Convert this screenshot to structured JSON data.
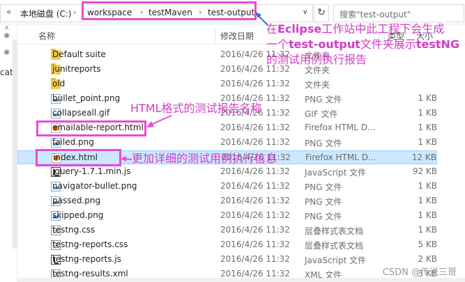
{
  "address": {
    "drive": "本地磁盘 (C:)",
    "crumbs": [
      "workspace",
      "testMaven",
      "test-output"
    ],
    "search_placeholder": "搜索\"test-output\""
  },
  "nav": {
    "partial_label": "cat"
  },
  "columns": {
    "name": "名称",
    "date": "修改日期",
    "type": "类型",
    "size": "大小"
  },
  "files": [
    {
      "name": "Default suite",
      "date": "2016/4/26 11:32",
      "type": "文件夹",
      "size": "",
      "icon": "folder-icon"
    },
    {
      "name": "junitreports",
      "date": "2016/4/26 11:32",
      "type": "文件夹",
      "size": "",
      "icon": "folder-icon"
    },
    {
      "name": "old",
      "date": "2016/4/26 11:32",
      "type": "文件夹",
      "size": "",
      "icon": "folder-icon"
    },
    {
      "name": "bullet_point.png",
      "date": "2016/4/26 11:32",
      "type": "PNG 文件",
      "size": "1 KB",
      "icon": "png-file-icon"
    },
    {
      "name": "collapseall.gif",
      "date": "2016/4/26 11:32",
      "type": "GIF 文件",
      "size": "1 KB",
      "icon": "gif-file-icon"
    },
    {
      "name": "emailable-report.html",
      "date": "2016/4/26 11:32",
      "type": "Firefox HTML D...",
      "size": "1 KB",
      "icon": "firefox-html-icon"
    },
    {
      "name": "failed.png",
      "date": "2016/4/26 11:32",
      "type": "PNG 文件",
      "size": "1 KB",
      "icon": "png-file-icon"
    },
    {
      "name": "index.html",
      "date": "2016/4/26 11:32",
      "type": "Firefox HTML D...",
      "size": "12 KB",
      "icon": "firefox-html-icon"
    },
    {
      "name": "jquery-1.7.1.min.js",
      "date": "2016/4/26 11:32",
      "type": "JavaScript 文件",
      "size": "92 KB",
      "icon": "js-file-icon"
    },
    {
      "name": "navigator-bullet.png",
      "date": "2016/4/26 11:32",
      "type": "PNG 文件",
      "size": "1 KB",
      "icon": "png-file-icon"
    },
    {
      "name": "passed.png",
      "date": "2016/4/26 11:32",
      "type": "PNG 文件",
      "size": "1 KB",
      "icon": "png-file-icon"
    },
    {
      "name": "skipped.png",
      "date": "2016/4/26 11:32",
      "type": "PNG 文件",
      "size": "1 KB",
      "icon": "png-file-icon"
    },
    {
      "name": "testng.css",
      "date": "2016/4/26 11:32",
      "type": "层叠样式表文档",
      "size": "1 KB",
      "icon": "css-file-icon"
    },
    {
      "name": "testng-reports.css",
      "date": "2016/4/26 11:32",
      "type": "层叠样式表文档",
      "size": "5 KB",
      "icon": "css-file-icon"
    },
    {
      "name": "testng-reports.js",
      "date": "2016/4/26 11:32",
      "type": "JavaScript 文件",
      "size": "2 KB",
      "icon": "js-file-icon"
    },
    {
      "name": "testng-results.xml",
      "date": "2016/4/26 11:32",
      "type": "XML 文件",
      "size": "3 KB",
      "icon": "xml-file-icon"
    }
  ],
  "annotations": {
    "top_line1_pre": "在",
    "top_line1_bold": "Eclipse",
    "top_line1_post": "工作站中此工程下会生成",
    "top_line2_pre": "一个",
    "top_line2_bold": "test-output",
    "top_line2_mid": "文件夹展示",
    "top_line2_bold2": "testNG",
    "top_line3": "的测试用例执行报告",
    "html_report_name": "HTML格式的测试报告名称",
    "detailed_info": "更加详细的测试用例执行信息"
  },
  "watermark": "CSDN @传说三哥",
  "colors": {
    "highlight": "#e84ad8",
    "selected_row": "#cce8ff"
  }
}
